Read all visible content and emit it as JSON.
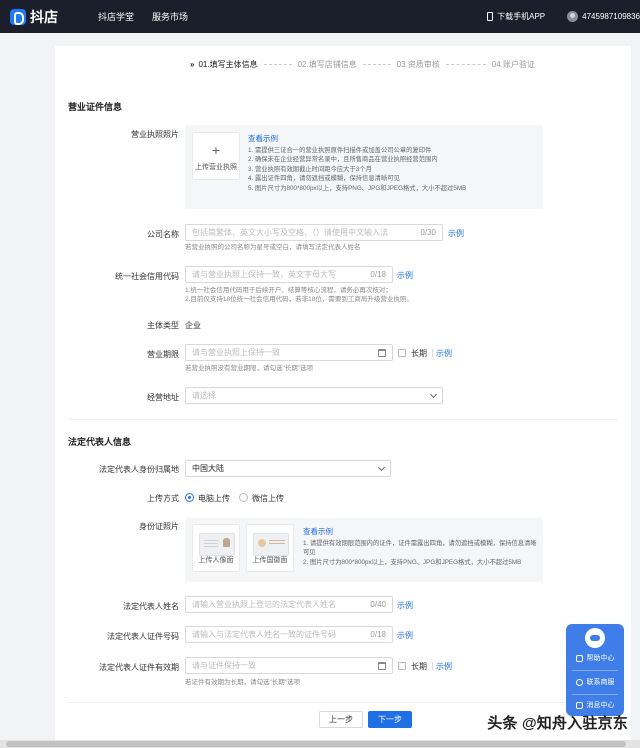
{
  "topbar": {
    "logo_text": "抖店",
    "nav": [
      "抖店学堂",
      "服务市场"
    ],
    "download_label": "下载手机APP",
    "user_id": "4745987109836"
  },
  "steps": [
    {
      "label": "01.填写主体信息",
      "active": true
    },
    {
      "label": "02.填写店铺信息",
      "active": false
    },
    {
      "label": "03.资质审核",
      "active": false
    },
    {
      "label": "04.账户验证",
      "active": false
    }
  ],
  "business_section": {
    "title": "营业证件信息",
    "license_photo": {
      "label": "营业执照照片",
      "upload_label": "上传营业执照",
      "tips_title": "查看示例",
      "tips": [
        "1. 需提供三证合一的营业执照原件扫描件或加盖公司公章的复印件",
        "2. 确保未在企业经营异常名录中，且所售商品在营业执照经营范围内",
        "3. 营业执照有效期截止时间距今应大于3个月",
        "4. 露出证件四角，请勿遮挡或模糊，保持信息清晰可见",
        "5. 图片尺寸为800*800px以上，支持PNG、JPG和JPEG格式，大小不超过5MB"
      ]
    },
    "company_name": {
      "label": "公司名称",
      "placeholder": "包括简繁体、英文大小写及空格、（）请使用中文输入法",
      "count": "0/30",
      "example": "示例",
      "hint": "若营业执照的公司名称为星号或空白，请填写法定代表人姓名"
    },
    "credit_code": {
      "label": "统一社会信用代码",
      "placeholder": "请与营业执照上保持一致，英文字母大写",
      "count": "0/18",
      "example": "示例",
      "hint1": "1.统一社会信用代码用于后续开户、结算等核心流程，请务必再次核对；",
      "hint2": "2.目前仅支持18位统一社会信用代码，若非18位，需要到工商局升级营业执照。"
    },
    "entity_type": {
      "label": "主体类型",
      "value": "企业"
    },
    "validity": {
      "label": "营业期限",
      "placeholder": "请与营业执照上保持一致",
      "long_term": "长期",
      "example": "示例",
      "hint": "若营业执照没有营业期限，请勾选\"长期\"选项"
    },
    "address": {
      "label": "经营地址",
      "placeholder": "请选择"
    }
  },
  "legal_section": {
    "title": "法定代表人信息",
    "region": {
      "label": "法定代表人身份归属地",
      "value": "中国大陆"
    },
    "upload_method": {
      "label": "上传方式",
      "option1": "电脑上传",
      "option2": "微信上传"
    },
    "id_photo": {
      "label": "身份证照片",
      "front_label": "上传人像面",
      "back_label": "上传国徽面",
      "tips_title": "查看示例",
      "tips": [
        "1. 请提供有效期限范围内的证件，证件需露出四角，请勿遮挡或模糊，保持信息清晰可见",
        "2. 图片尺寸为800*800px以上，支持PNG、JPG和JPEG格式，大小不超过5MB"
      ]
    },
    "name": {
      "label": "法定代表人姓名",
      "placeholder": "请输入营业执照上登记的法定代表人姓名",
      "count": "0/40",
      "example": "示例"
    },
    "id_number": {
      "label": "法定代表人证件号码",
      "placeholder": "请输入与法定代表人姓名一致的证件号码",
      "count": "0/18",
      "example": "示例"
    },
    "id_validity": {
      "label": "法定代表人证件有效期",
      "placeholder": "请与证件保持一致",
      "long_term": "长期",
      "example": "示例",
      "hint": "若证件有效期为长期，请勾选\"长期\"选项"
    }
  },
  "buttons": {
    "prev": "上一步",
    "next": "下一步"
  },
  "helper": {
    "help": "帮助中心",
    "contact": "联系商服",
    "message": "消息中心"
  },
  "watermark": "头条 @知舟入驻京东",
  "colors": {
    "accent": "#1f6fe5",
    "topbar": "#1b1e2b",
    "helper": "#3f7ee8"
  }
}
